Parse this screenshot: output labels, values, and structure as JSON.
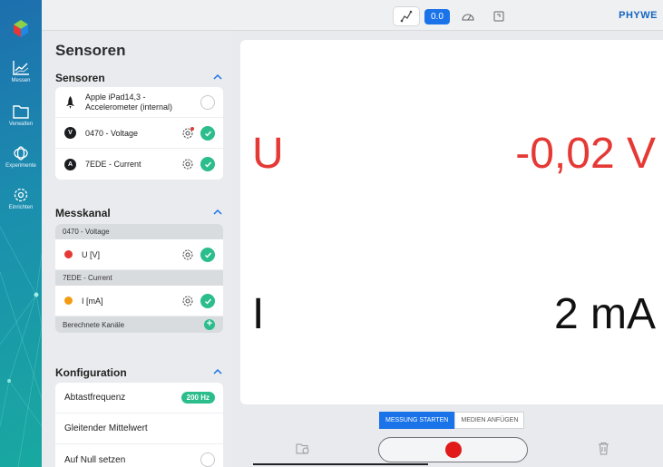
{
  "rail": {
    "items": [
      {
        "label": "Messen",
        "icon": "chart-icon"
      },
      {
        "label": "Verwalten",
        "icon": "folder-icon"
      },
      {
        "label": "Experimente",
        "icon": "experiments-icon"
      },
      {
        "label": "Einrichten",
        "icon": "gear-icon"
      }
    ]
  },
  "topbar": {
    "value_label": "0.0",
    "brand": "PHYWE"
  },
  "panel": {
    "title": "Sensoren",
    "sensors": {
      "heading": "Sensoren",
      "items": [
        {
          "label": "Apple iPad14,3 - Accelerometer (internal)",
          "checked": false
        },
        {
          "label": "0470 - Voltage",
          "badge": "V",
          "checked": true
        },
        {
          "label": "7EDE - Current",
          "badge": "A",
          "checked": true
        }
      ]
    },
    "channels": {
      "heading": "Messkanal",
      "group1": "0470 - Voltage",
      "ch1": "U [V]",
      "group2": "7EDE - Current",
      "ch2": "I [mA]",
      "computed": "Berechnete Kanäle"
    },
    "config": {
      "heading": "Konfiguration",
      "rate_label": "Abtastfrequenz",
      "rate_value": "200 Hz",
      "moving_avg": "Gleitender Mittelwert",
      "zero": "Auf Null setzen"
    }
  },
  "display": {
    "u_symbol": "U",
    "u_value": "-0,02 V",
    "i_symbol": "I",
    "i_value": "2 mA",
    "u_color": "#e53935",
    "i_color": "#111111"
  },
  "bottom": {
    "tab_start": "MESSUNG STARTEN",
    "tab_media": "MEDIEN ANFÜGEN"
  },
  "colors": {
    "accent": "#1a73e8",
    "ok": "#2bbd8c",
    "record": "#e11a1a",
    "channel_u": "#e53935",
    "channel_i": "#f39c12"
  }
}
